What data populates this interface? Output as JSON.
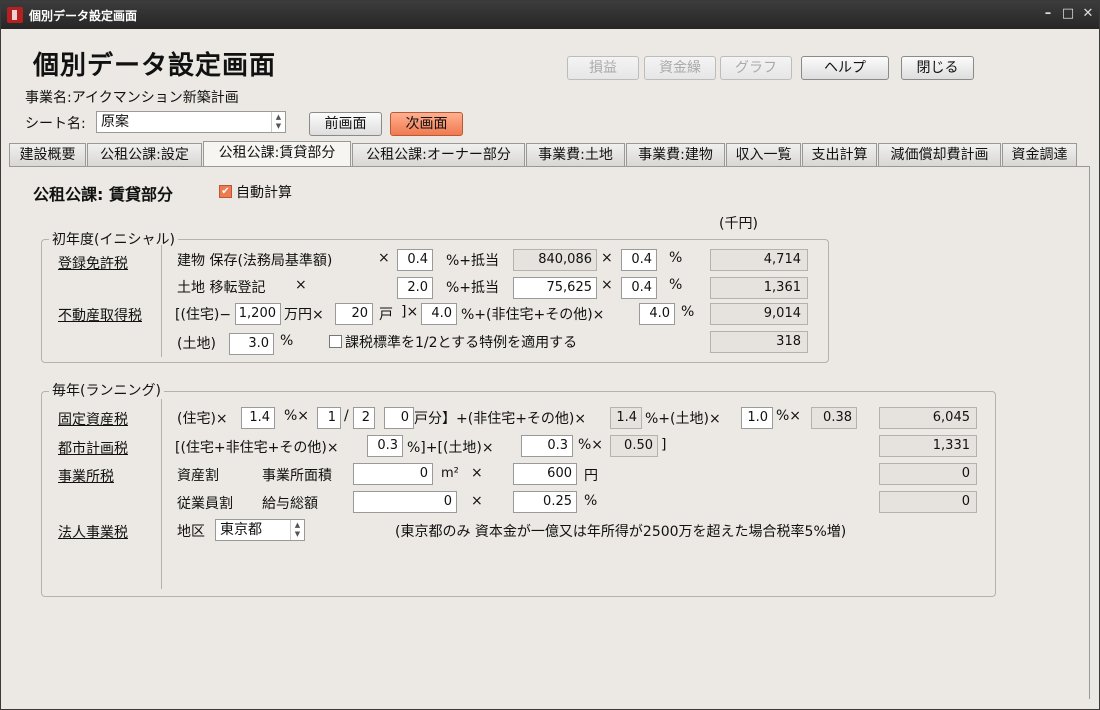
{
  "window": {
    "title": "個別データ設定画面"
  },
  "header": {
    "title": "個別データ設定画面",
    "project_label": "事業名:アイクマンション新築計画",
    "sheet_label": "シート名:",
    "sheet_value": "原案",
    "prev_label": "前画面",
    "next_label": "次画面",
    "buttons": {
      "soneki": "損益",
      "shikinkuri": "資金繰",
      "graph": "グラフ",
      "help": "ヘルプ",
      "close": "閉じる"
    }
  },
  "tabs": [
    "建設概要",
    "公租公課:設定",
    "公租公課:賃貸部分",
    "公租公課:オーナー部分",
    "事業費:土地",
    "事業費:建物",
    "収入一覧",
    "支出計算",
    "減価償却費計画",
    "資金調達"
  ],
  "section": {
    "title": "公租公課: 賃貸部分",
    "auto_calc_label": "自動計算",
    "unit": "(千円)"
  },
  "initial": {
    "group_title": "初年度(イニシャル)",
    "registration_tax_link": "登録免許税",
    "acquisition_tax_link": "不動産取得税",
    "building_row": {
      "label": "建物 保存(法務局基準額)",
      "times1": "×",
      "rate": "0.4",
      "pct_plus": "%+抵当",
      "base": "840,086",
      "times2": "×",
      "rate2": "0.4",
      "pct": "%",
      "result": "4,714"
    },
    "land_row": {
      "label": "土地 移転登記",
      "times1": "×",
      "rate": "2.0",
      "pct_plus": "%+抵当",
      "base": "75,625",
      "times2": "×",
      "rate2": "0.4",
      "pct": "%",
      "result": "1,361"
    },
    "acq_row": {
      "pre": "[(住宅)−",
      "amount": "1,200",
      "unit1": "万円×",
      "units": "20",
      "unit2": "戸",
      "close": "]×",
      "rate": "4.0",
      "mid": "%+(非住宅+その他)×",
      "rate2": "4.0",
      "pct": "%",
      "result": "9,014"
    },
    "land_acq_row": {
      "pre": "(土地)",
      "rate": "3.0",
      "pct": "%",
      "special_label": "課税標準を1/2とする特例を適用する",
      "result": "318"
    }
  },
  "yearly": {
    "group_title": "毎年(ランニング)",
    "fixed_asset_link": "固定資産税",
    "city_plan_link": "都市計画税",
    "office_tax_link": "事業所税",
    "corp_tax_link": "法人事業税",
    "fixed_row": {
      "pre": "(住宅)×",
      "rate": "1.4",
      "mid1": "%×",
      "num": "1",
      "slash": "/",
      "den": "2",
      "bracket": "【",
      "units": "0",
      "post_units": "戸分】+(非住宅+その他)×",
      "rate2": "1.4",
      "mid2": "%+(土地)×",
      "rate3": "1.0",
      "mid3": "%×",
      "factor": "0.38",
      "result": "6,045"
    },
    "city_row": {
      "pre": "[(住宅+非住宅+その他)×",
      "rate": "0.3",
      "mid": "%]+[(土地)×",
      "rate2": "0.3",
      "mid2": "%×",
      "factor": "0.50",
      "close": "]",
      "result": "1,331"
    },
    "office_asset_row": {
      "label1": "資産割",
      "label2": "事業所面積",
      "area": "0",
      "unit": "m²",
      "times": "×",
      "rate": "600",
      "yen": "円",
      "result": "0"
    },
    "office_emp_row": {
      "label1": "従業員割",
      "label2": "給与総額",
      "amount": "0",
      "times": "×",
      "rate": "0.25",
      "pct": "%",
      "result": "0"
    },
    "corp_row": {
      "label": "地区",
      "region": "東京都",
      "note": "(東京都のみ 資本金が一億又は年所得が2500万を超えた場合税率5%増)"
    }
  }
}
